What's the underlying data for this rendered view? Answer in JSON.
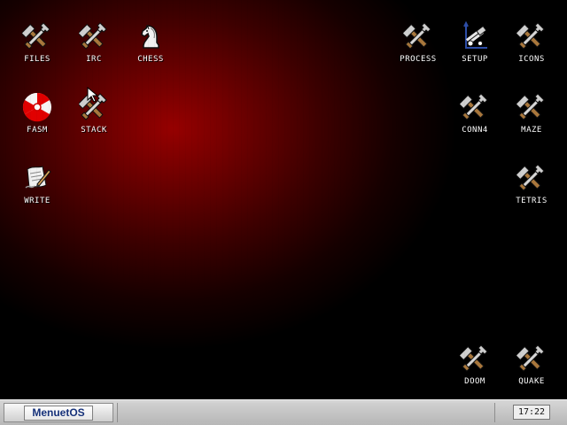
{
  "desktop": {
    "icons": [
      {
        "label": "FILES",
        "icon": "tools-icon"
      },
      {
        "label": "IRC",
        "icon": "tools-icon"
      },
      {
        "label": "CHESS",
        "icon": "chess-knight-icon"
      },
      {
        "label": "FASM",
        "icon": "radiation-icon"
      },
      {
        "label": "STACK",
        "icon": "tools-icon"
      },
      {
        "label": "WRITE",
        "icon": "write-icon"
      },
      {
        "label": "PROCESS",
        "icon": "tools-icon"
      },
      {
        "label": "SETUP",
        "icon": "setup-icon"
      },
      {
        "label": "ICONS",
        "icon": "tools-icon"
      },
      {
        "label": "CONN4",
        "icon": "tools-icon"
      },
      {
        "label": "MAZE",
        "icon": "tools-icon"
      },
      {
        "label": "TETRIS",
        "icon": "tools-icon"
      },
      {
        "label": "DOOM",
        "icon": "tools-icon"
      },
      {
        "label": "QUAKE",
        "icon": "tools-icon"
      }
    ]
  },
  "taskbar": {
    "start_label": "MenuetOS",
    "clock": "17:22"
  },
  "colors": {
    "desktop_glow": "#960000",
    "desktop_edge": "#000000",
    "taskbar": "#c4c4c4",
    "start_text": "#17327a"
  }
}
